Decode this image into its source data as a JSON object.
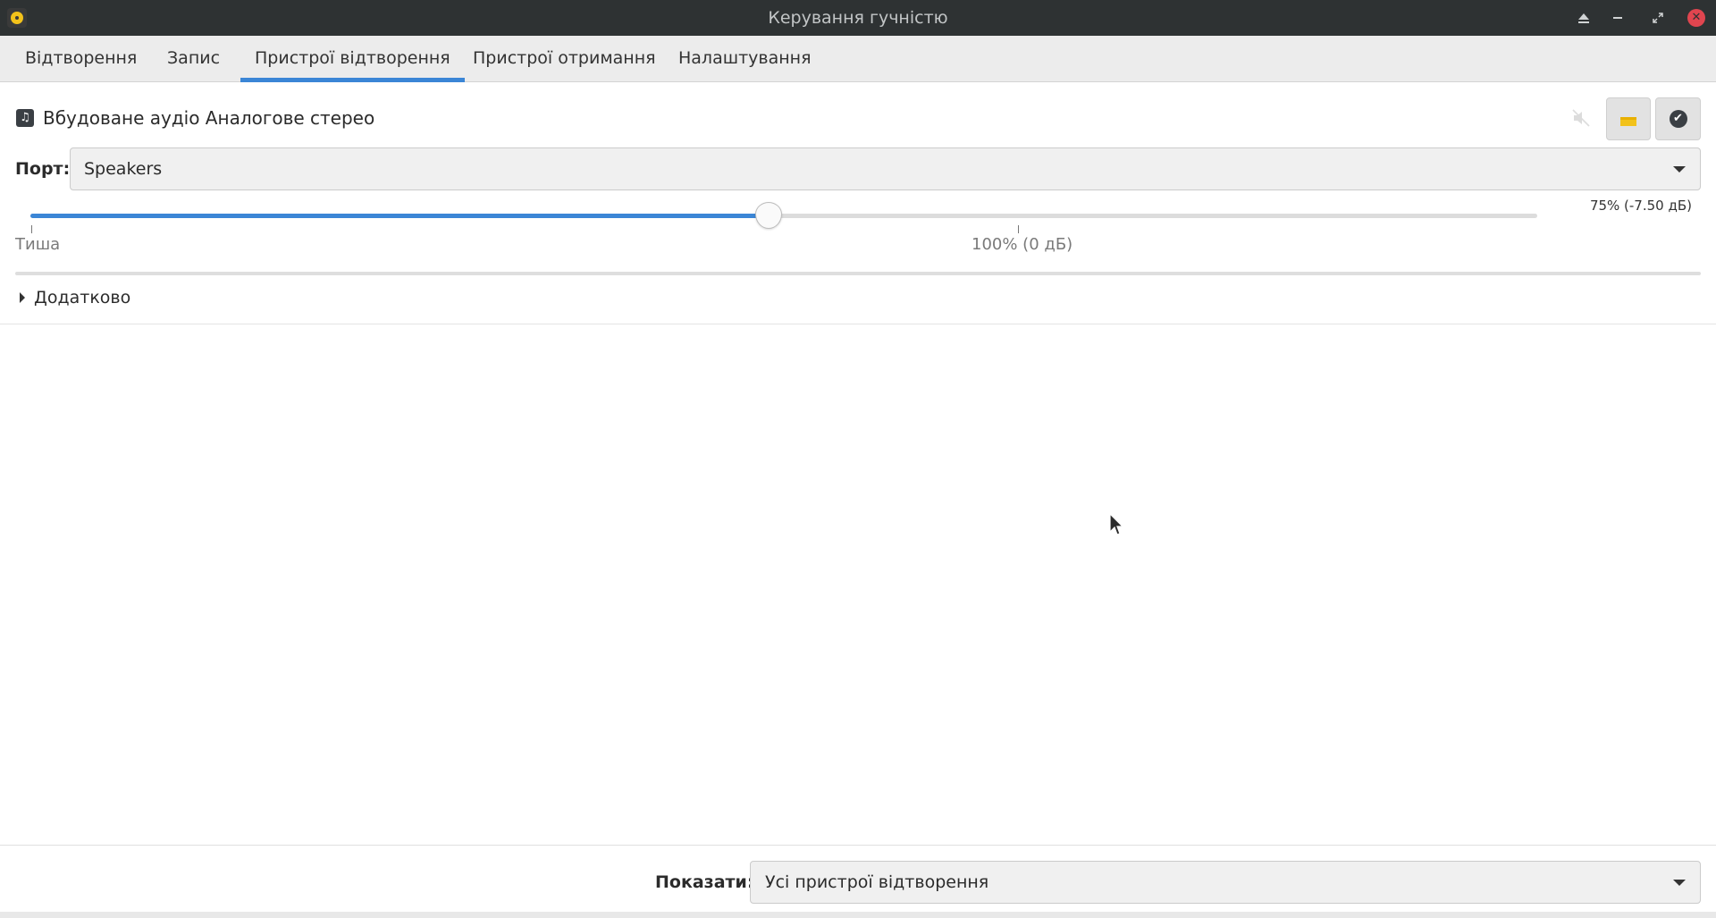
{
  "window": {
    "title": "Керування гучністю",
    "controls": [
      "shade",
      "minimize",
      "maximize",
      "close"
    ]
  },
  "tabs": [
    {
      "label": "Відтворення",
      "active": false
    },
    {
      "label": "Запис",
      "active": false
    },
    {
      "label": "Пристрої відтворення",
      "active": true
    },
    {
      "label": "Пристрої отримання",
      "active": false
    },
    {
      "label": "Налаштування",
      "active": false
    }
  ],
  "device": {
    "name": "Вбудоване аудіо Аналогове стерео",
    "icon": "audio-card-icon",
    "mute_icon": "speaker-muted-icon",
    "lock_icon": "lock-channels-icon",
    "default_icon": "checkmark-icon",
    "port_label": "Порт:",
    "port_value": "Speakers"
  },
  "volume": {
    "value_text": "75% (-7.50 дБ)",
    "percent": 75,
    "max_percent": 153,
    "accent": "#3b86d6",
    "mark_silence": "Тиша",
    "mark_100": "100% (0 дБ)"
  },
  "advanced": {
    "label": "Додатково",
    "expanded": false
  },
  "footer": {
    "show_label": "Показати:",
    "show_value": "Усі пристрої відтворення"
  }
}
